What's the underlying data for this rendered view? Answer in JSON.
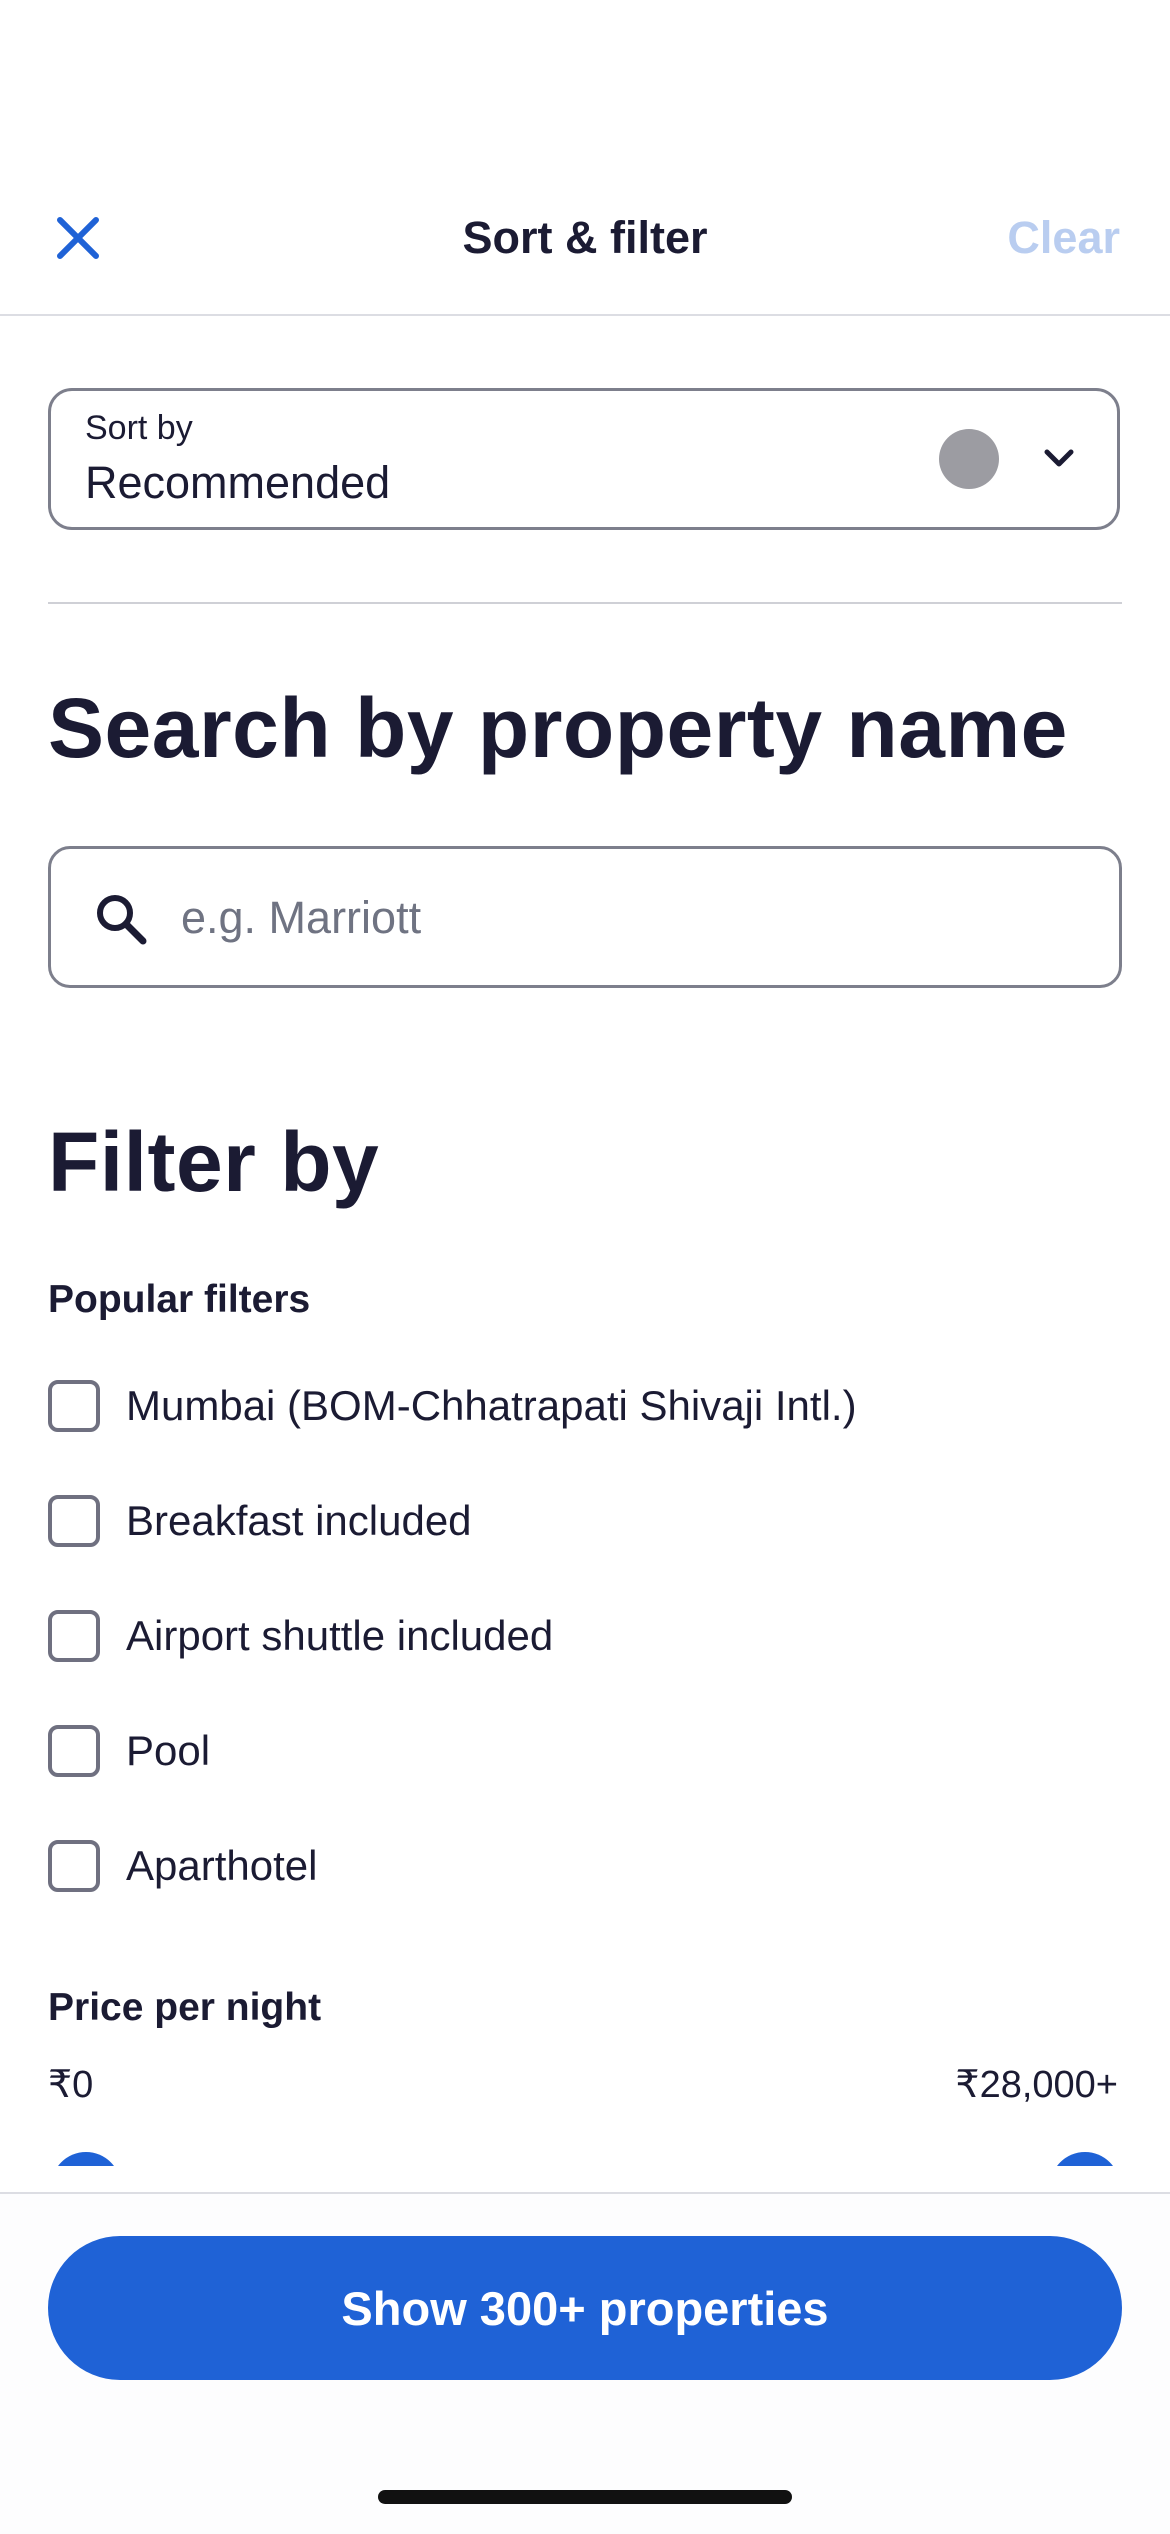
{
  "header": {
    "title": "Sort & filter",
    "clear_label": "Clear"
  },
  "sort": {
    "label": "Sort by",
    "value": "Recommended"
  },
  "search": {
    "title": "Search by property name",
    "placeholder": "e.g. Marriott"
  },
  "filter": {
    "title": "Filter by",
    "popular_heading": "Popular filters",
    "popular_items": [
      {
        "label": "Mumbai (BOM-Chhatrapati Shivaji Intl.)",
        "checked": false
      },
      {
        "label": "Breakfast included",
        "checked": false
      },
      {
        "label": "Airport shuttle included",
        "checked": false
      },
      {
        "label": "Pool",
        "checked": false
      },
      {
        "label": "Aparthotel",
        "checked": false
      }
    ],
    "price_heading": "Price per night",
    "price_min": "₹0",
    "price_max": "₹28,000+"
  },
  "footer": {
    "show_label": "Show 300+ properties"
  },
  "colors": {
    "accent": "#1f62d6",
    "clear_disabled": "#b9cdf0",
    "text": "#1b1b33"
  }
}
